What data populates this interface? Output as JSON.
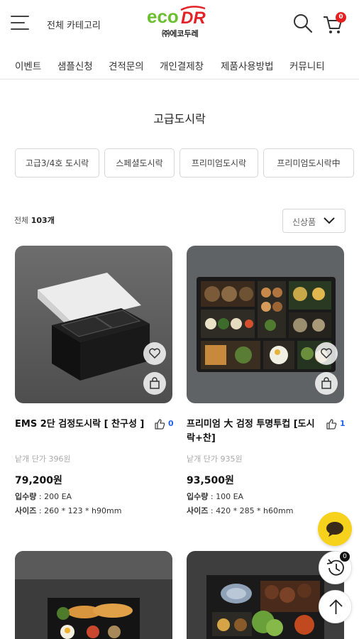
{
  "header": {
    "category_label": "전체 카테고리",
    "logo_text": "eco DR",
    "logo_sub": "㈜에코두레",
    "cart_count": "0"
  },
  "nav": [
    "이벤트",
    "샘플신청",
    "견적문의",
    "개인결제창",
    "제품사용방법",
    "커뮤니티"
  ],
  "page_title": "고급도시락",
  "chips": [
    "고급3/4호 도시락",
    "스페셜도시락",
    "프리미엄도시락",
    "프리미엄도시락中"
  ],
  "count": {
    "prefix": "전체",
    "number": "103개"
  },
  "sort_label": "신상품",
  "products": [
    {
      "name": "EMS 2단 검정도시락 [ 찬구성 ]",
      "likes": "0",
      "unit_price": "낱개 단가 396원",
      "price": "79,200원",
      "qty_label": "입수량",
      "qty_value": ": 200 EA",
      "size_label": "사이즈",
      "size_value": ": 260 * 123 * h90mm"
    },
    {
      "name": "프리미엄 大 검정 투명투컵 [도시락+찬]",
      "likes": "1",
      "unit_price": "낱개 단가 935원",
      "price": "93,500원",
      "qty_label": "입수량",
      "qty_value": ": 100 EA",
      "size_label": "사이즈",
      "size_value": ": 420 * 285 * h60mm"
    }
  ],
  "history_count": "0",
  "colors": {
    "brand_green": "#6cbf2e",
    "brand_red": "#e32227",
    "like_blue": "#2563eb",
    "chat_yellow": "#f7d21d"
  }
}
